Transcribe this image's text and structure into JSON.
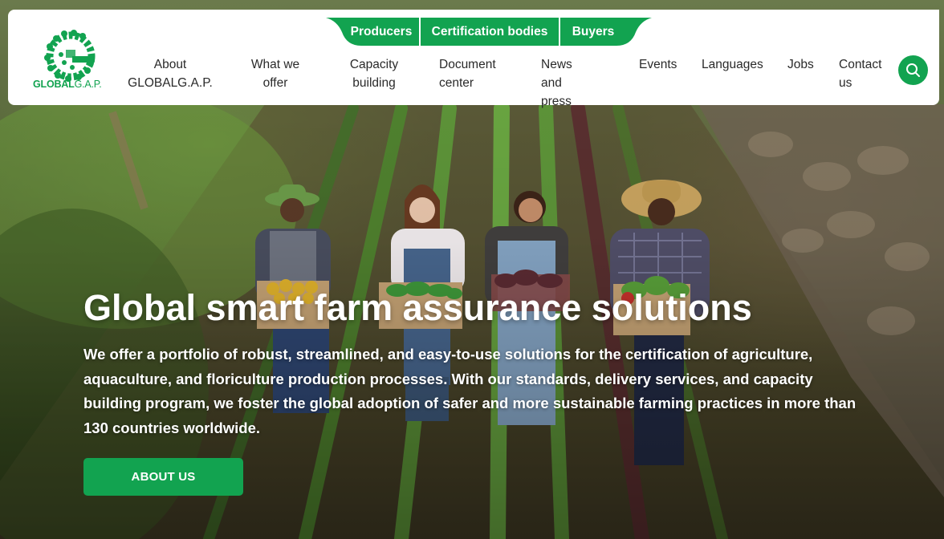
{
  "brand": {
    "logo_text_bold": "GLOBAL",
    "logo_text_light": "G.A.P.",
    "primary_color": "#12a350"
  },
  "top_tabs": [
    {
      "label": "Producers"
    },
    {
      "label": "Certification bodies"
    },
    {
      "label": "Buyers"
    }
  ],
  "nav": {
    "items": [
      {
        "line1": "About",
        "line2": "GLOBALG.A.P."
      },
      {
        "line1": "What we",
        "line2": "offer"
      },
      {
        "line1": "Capacity",
        "line2": "building"
      },
      {
        "line1": "Document",
        "line2": "center"
      },
      {
        "line1": "News and",
        "line2": "press"
      },
      {
        "line1": "Events",
        "line2": ""
      },
      {
        "line1": "Languages",
        "line2": ""
      },
      {
        "line1": "Jobs",
        "line2": ""
      },
      {
        "line1": "Contact",
        "line2": "us"
      }
    ],
    "search_icon": "search-icon"
  },
  "hero": {
    "title": "Global smart farm assurance solutions",
    "description": "We offer a portfolio of robust, streamlined, and easy-to-use solutions for the certification of agriculture, aquaculture, and floriculture production processes. With our standards, delivery services, and capacity building program, we foster the global adoption of safer and more sustainable farming practices in more than 130 countries worldwide.",
    "button_label": "ABOUT US"
  }
}
